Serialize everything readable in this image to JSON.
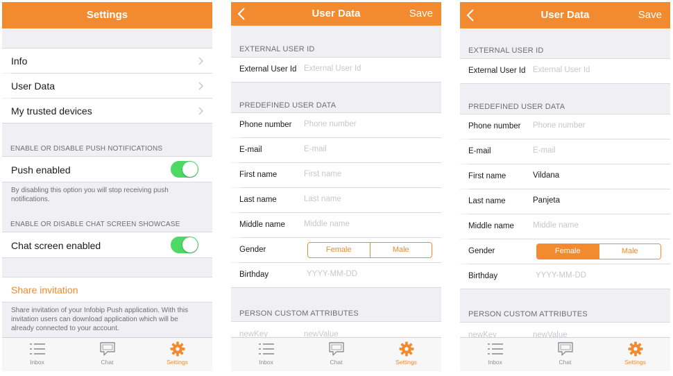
{
  "colors": {
    "accent": "#f28a2f",
    "toggle_on": "#4cd964",
    "background": "#efeff4"
  },
  "tabs": [
    {
      "label": "Inbox",
      "icon": "list-icon"
    },
    {
      "label": "Chat",
      "icon": "chat-bubble-icon"
    },
    {
      "label": "Settings",
      "icon": "gear-icon"
    }
  ],
  "settings": {
    "title": "Settings",
    "menu": [
      {
        "label": "Info"
      },
      {
        "label": "User Data"
      },
      {
        "label": "My trusted devices"
      }
    ],
    "push_header": "ENABLE OR DISABLE PUSH NOTIFICATIONS",
    "push_label": "Push enabled",
    "push_enabled": true,
    "push_footer": "By disabling this option you will stop receiving push notifications.",
    "chat_header": "ENABLE OR DISABLE CHAT SCREEN SHOWCASE",
    "chat_label": "Chat screen enabled",
    "chat_enabled": true,
    "share_label": "Share invitation",
    "share_footer": "Share invitation of your Infobip Push application. With this invitation users can download application which will be already connected to your account."
  },
  "user_data_empty": {
    "title": "User Data",
    "save_label": "Save",
    "external_header": "EXTERNAL USER ID",
    "external_label": "External User Id",
    "external_placeholder": "External User Id",
    "external_value": "",
    "predefined_header": "PREDEFINED USER DATA",
    "fields": [
      {
        "label": "Phone number",
        "placeholder": "Phone number",
        "value": ""
      },
      {
        "label": "E-mail",
        "placeholder": "E-mail",
        "value": ""
      },
      {
        "label": "First name",
        "placeholder": "First name",
        "value": ""
      },
      {
        "label": "Last name",
        "placeholder": "Last name",
        "value": ""
      },
      {
        "label": "Middle name",
        "placeholder": "Middle name",
        "value": ""
      }
    ],
    "gender_label": "Gender",
    "gender_options": [
      "Female",
      "Male"
    ],
    "gender_selected": "",
    "birthday_label": "Birthday",
    "birthday_placeholder": "YYYY-MM-DD",
    "custom_header": "PERSON CUSTOM ATTRIBUTES",
    "custom_key_placeholder": "newKey",
    "custom_value_placeholder": "newValue"
  },
  "user_data_filled": {
    "title": "User Data",
    "save_label": "Save",
    "external_header": "EXTERNAL USER ID",
    "external_label": "External User Id",
    "external_placeholder": "External User Id",
    "external_value": "",
    "predefined_header": "PREDEFINED USER DATA",
    "fields": [
      {
        "label": "Phone number",
        "placeholder": "Phone number",
        "value": ""
      },
      {
        "label": "E-mail",
        "placeholder": "E-mail",
        "value": ""
      },
      {
        "label": "First name",
        "placeholder": "First name",
        "value": "Vildana"
      },
      {
        "label": "Last name",
        "placeholder": "Last name",
        "value": "Panjeta"
      },
      {
        "label": "Middle name",
        "placeholder": "Middle name",
        "value": ""
      }
    ],
    "gender_label": "Gender",
    "gender_options": [
      "Female",
      "Male"
    ],
    "gender_selected": "Female",
    "birthday_label": "Birthday",
    "birthday_placeholder": "YYYY-MM-DD",
    "custom_header": "PERSON CUSTOM ATTRIBUTES",
    "custom_key_placeholder": "newKey",
    "custom_value_placeholder": "newValue"
  }
}
